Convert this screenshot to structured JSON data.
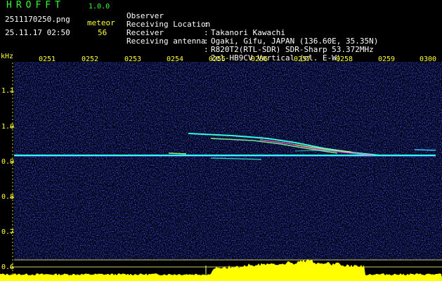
{
  "header": {
    "app_title": "HROFFT",
    "app_version": "1.0.0",
    "file_name": "2511170250.png",
    "date_time": "25.11.17 02:50",
    "mode_label": "meteor",
    "count_value": "56"
  },
  "info": [
    {
      "key": "Observer",
      "value": "Takanori Kawachi"
    },
    {
      "key": "Receiving Location",
      "value": "Ogaki, Gifu, JAPAN (136.60E, 35.35N)"
    },
    {
      "key": "Receiver",
      "value": "R820T2(RTL-SDR) SDR-Sharp 53.372MHz"
    },
    {
      "key": "Receiving antenna",
      "value": "2el-HB9CV Vertical (el. E-W)"
    }
  ],
  "axis": {
    "y_unit": "kHz",
    "y_ticks": [
      "1.1",
      "1.0",
      "0.9",
      "0.8",
      "0.7",
      "0.6"
    ],
    "x_ticks": [
      "0251",
      "0252",
      "0253",
      "0254",
      "0255",
      "0256",
      "0257",
      "0258",
      "0259",
      "0300"
    ]
  },
  "colors": {
    "background": "#000000",
    "label_yellow": "#ffff33",
    "title_green": "#33ff33",
    "noise_blue": "#1a2ad8",
    "carrier_cyan": "#33ffee",
    "spectrum_fill": "#ffff00",
    "baseline_cyan": "#33ccff"
  }
}
